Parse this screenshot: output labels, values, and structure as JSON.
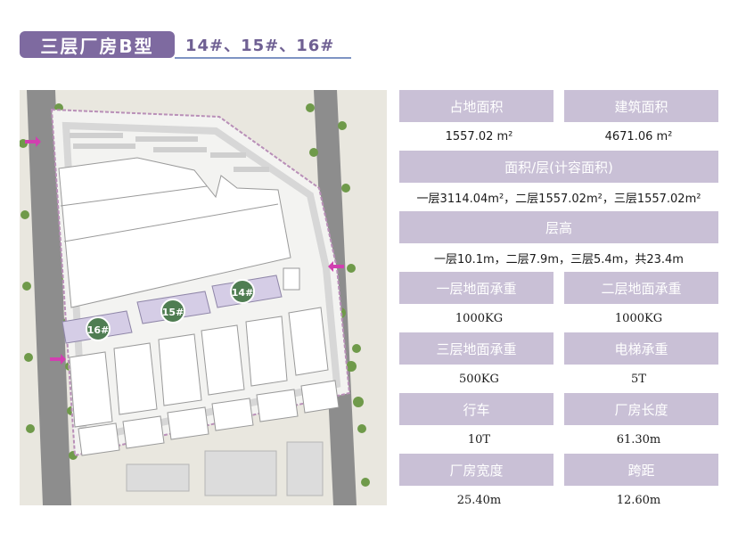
{
  "header": {
    "title": "三层厂房B型",
    "subtitle": "14#、15#、16#"
  },
  "site_plan": {
    "building_labels": [
      "16#",
      "15#",
      "14#"
    ]
  },
  "table": {
    "row1": {
      "h1": "占地面积",
      "h2": "建筑面积",
      "v1": "1557.02 m²",
      "v2": "4671.06 m²"
    },
    "row2": {
      "h": "面积/层(计容面积)",
      "v": "一层3114.04m²，二层1557.02m²，三层1557.02m²"
    },
    "row3": {
      "h": "层高",
      "v": "一层10.1m，二层7.9m，三层5.4m，共23.4m"
    },
    "row4": {
      "h1": "一层地面承重",
      "h2": "二层地面承重",
      "v1": "1000KG",
      "v2": "1000KG"
    },
    "row5": {
      "h1": "三层地面承重",
      "h2": "电梯承重",
      "v1": "500KG",
      "v2": "5T"
    },
    "row6": {
      "h1": "行车",
      "h2": "厂房长度",
      "v1": "10T",
      "v2": "61.30m"
    },
    "row7": {
      "h1": "厂房宽度",
      "h2": "跨距",
      "v1": "25.40m",
      "v2": "12.60m"
    }
  },
  "colors": {
    "title_badge": "#7e6aa0",
    "header_cell": "#c9c0d6",
    "highlight_building": "#d5cde6",
    "label_circle": "#4f7d52"
  }
}
